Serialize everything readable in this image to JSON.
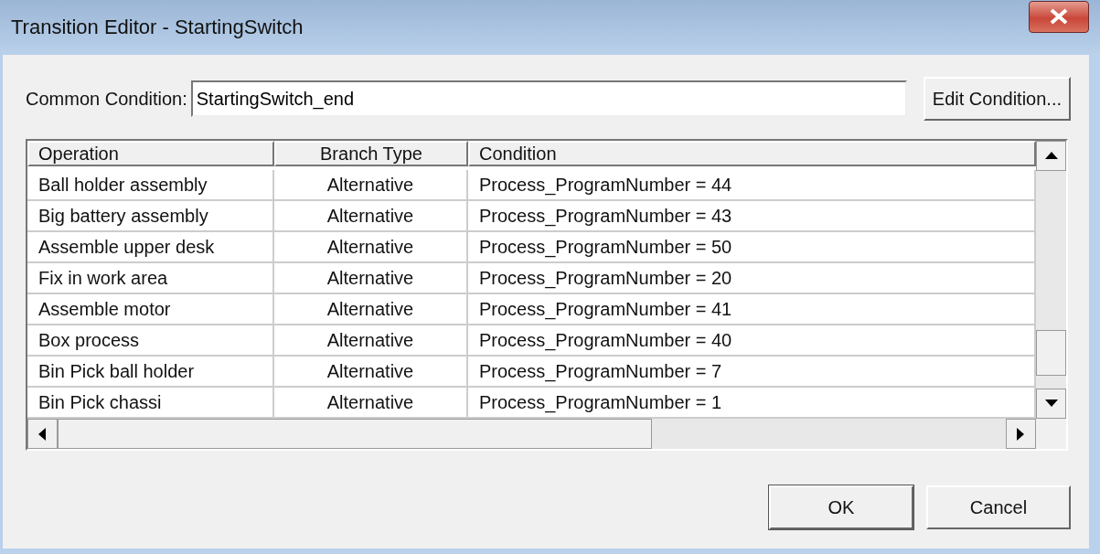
{
  "window": {
    "title": "Transition Editor - StartingSwitch"
  },
  "common_condition": {
    "label": "Common Condition:",
    "value": "StartingSwitch_end",
    "button": "Edit Condition..."
  },
  "table": {
    "columns": [
      "Operation",
      "Branch Type",
      "Condition"
    ],
    "rows": [
      {
        "operation": "Ball holder assembly",
        "branch_type": "Alternative",
        "condition": "Process_ProgramNumber = 44"
      },
      {
        "operation": "Big battery assembly",
        "branch_type": "Alternative",
        "condition": "Process_ProgramNumber = 43"
      },
      {
        "operation": "Assemble upper desk",
        "branch_type": "Alternative",
        "condition": "Process_ProgramNumber = 50"
      },
      {
        "operation": "Fix in work area",
        "branch_type": "Alternative",
        "condition": "Process_ProgramNumber = 20"
      },
      {
        "operation": "Assemble motor",
        "branch_type": "Alternative",
        "condition": "Process_ProgramNumber = 41"
      },
      {
        "operation": "Box process",
        "branch_type": "Alternative",
        "condition": "Process_ProgramNumber = 40"
      },
      {
        "operation": "Bin Pick ball holder",
        "branch_type": "Alternative",
        "condition": "Process_ProgramNumber = 7"
      },
      {
        "operation": "Bin Pick chassi",
        "branch_type": "Alternative",
        "condition": "Process_ProgramNumber = 1"
      }
    ]
  },
  "buttons": [
    "OK",
    "Cancel"
  ]
}
